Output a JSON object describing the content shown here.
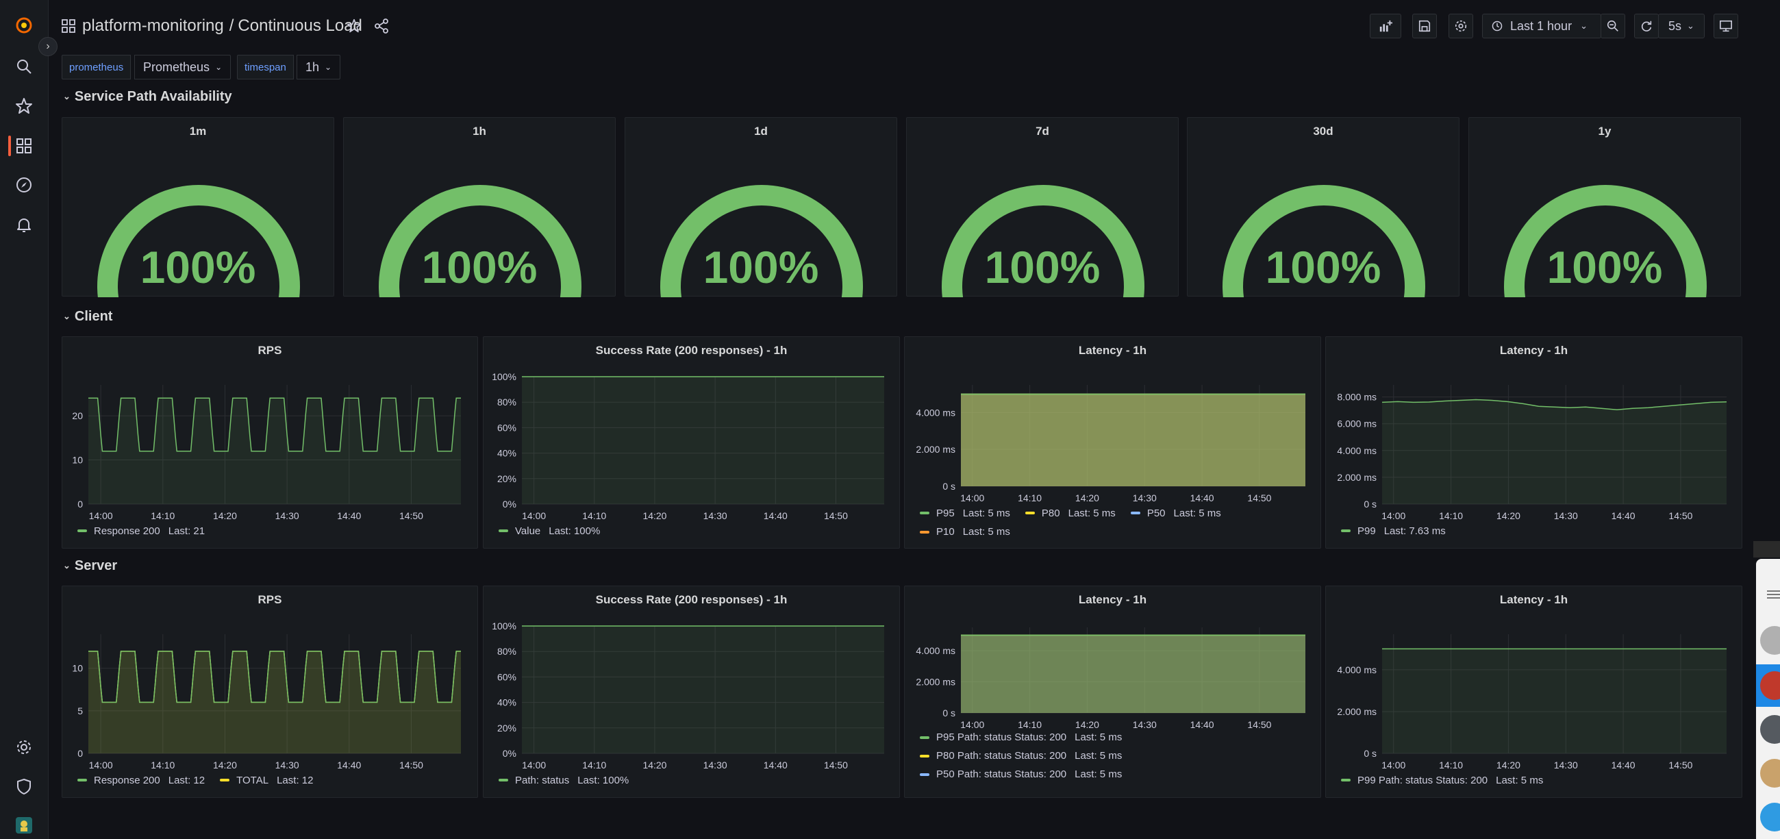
{
  "header": {
    "folder": "platform-monitoring",
    "separator": "/",
    "title": "Continuous Load",
    "time_range": "Last 1 hour",
    "refresh_interval": "5s"
  },
  "variables": [
    {
      "label": "prometheus",
      "value": "Prometheus"
    },
    {
      "label": "timespan",
      "value": "1h"
    }
  ],
  "rows": {
    "availability": "Service Path Availability",
    "client": "Client",
    "server": "Server"
  },
  "colors": {
    "green": "#73bf69",
    "yellow": "#fade2a",
    "blue": "#8ab8ff",
    "orange": "#ff9830",
    "accent": "#f55f3e"
  },
  "gauges": [
    {
      "title": "1m",
      "value": "100%"
    },
    {
      "title": "1h",
      "value": "100%"
    },
    {
      "title": "1d",
      "value": "100%"
    },
    {
      "title": "7d",
      "value": "100%"
    },
    {
      "title": "30d",
      "value": "100%"
    },
    {
      "title": "1y",
      "value": "100%"
    }
  ],
  "x_ticks_a": [
    "14:00",
    "14:10",
    "14:20",
    "14:30",
    "14:40",
    "14:50"
  ],
  "chart_data": [
    {
      "id": "client-rps",
      "type": "line",
      "title": "RPS",
      "y_ticks": [
        "0",
        "10",
        "20"
      ],
      "ylim": [
        0,
        27
      ],
      "series": [
        {
          "name": "Response 200",
          "last": "Last: 21",
          "color": "#73bf69",
          "pattern": "square-wave",
          "low": 12,
          "high": 24,
          "period_min": 6
        }
      ]
    },
    {
      "id": "client-success",
      "type": "line",
      "title": "Success Rate (200 responses) - 1h",
      "y_ticks": [
        "0%",
        "20%",
        "40%",
        "60%",
        "80%",
        "100%"
      ],
      "ylim": [
        0,
        100
      ],
      "series": [
        {
          "name": "Value",
          "last": "Last: 100%",
          "color": "#73bf69",
          "constant": 100
        }
      ]
    },
    {
      "id": "client-latency",
      "type": "area",
      "title": "Latency - 1h",
      "y_ticks": [
        "0 s",
        "2.000 ms",
        "4.000 ms"
      ],
      "ylim": [
        0,
        5500
      ],
      "series": [
        {
          "name": "P95",
          "last": "Last: 5 ms",
          "color": "#73bf69",
          "constant": 5000
        },
        {
          "name": "P80",
          "last": "Last: 5 ms",
          "color": "#fade2a",
          "constant": 5000
        },
        {
          "name": "P50",
          "last": "Last: 5 ms",
          "color": "#8ab8ff",
          "constant": 5000
        },
        {
          "name": "P10",
          "last": "Last: 5 ms",
          "color": "#ff9830",
          "constant": 5000
        }
      ]
    },
    {
      "id": "client-latency-p99",
      "type": "line",
      "title": "Latency - 1h",
      "y_ticks": [
        "0 s",
        "2.000 ms",
        "4.000 ms",
        "6.000 ms",
        "8.000 ms"
      ],
      "ylim": [
        0,
        8900
      ],
      "series": [
        {
          "name": "P99",
          "last": "Last: 7.63 ms",
          "color": "#73bf69",
          "values": [
            7600,
            7650,
            7600,
            7620,
            7700,
            7750,
            7800,
            7750,
            7650,
            7500,
            7300,
            7250,
            7200,
            7250,
            7150,
            7050,
            7150,
            7200,
            7300,
            7400,
            7500,
            7600,
            7630
          ]
        }
      ]
    },
    {
      "id": "server-rps",
      "type": "line",
      "title": "RPS",
      "y_ticks": [
        "0",
        "5",
        "10"
      ],
      "ylim": [
        0,
        14
      ],
      "series": [
        {
          "name": "Response 200",
          "last": "Last: 12",
          "color": "#73bf69",
          "pattern": "square-wave",
          "low": 6,
          "high": 12,
          "period_min": 6
        },
        {
          "name": "TOTAL",
          "last": "Last: 12",
          "color": "#fade2a",
          "pattern": "square-wave",
          "low": 6,
          "high": 12,
          "period_min": 6
        }
      ]
    },
    {
      "id": "server-success",
      "type": "line",
      "title": "Success Rate (200 responses) - 1h",
      "y_ticks": [
        "0%",
        "20%",
        "40%",
        "60%",
        "80%",
        "100%"
      ],
      "ylim": [
        0,
        100
      ],
      "series": [
        {
          "name": "Path: status",
          "last": "Last: 100%",
          "color": "#73bf69",
          "constant": 100
        }
      ]
    },
    {
      "id": "server-latency",
      "type": "area",
      "title": "Latency - 1h",
      "y_ticks": [
        "0 s",
        "2.000 ms",
        "4.000 ms"
      ],
      "ylim": [
        0,
        5500
      ],
      "series": [
        {
          "name": "P95 Path: status Status: 200",
          "last": "Last: 5 ms",
          "color": "#73bf69",
          "constant": 5000
        },
        {
          "name": "P80 Path: status Status: 200",
          "last": "Last: 5 ms",
          "color": "#fade2a",
          "constant": 5000
        },
        {
          "name": "P50 Path: status Status: 200",
          "last": "Last: 5 ms",
          "color": "#8ab8ff",
          "constant": 5000
        }
      ]
    },
    {
      "id": "server-latency-p99",
      "type": "line",
      "title": "Latency - 1h",
      "y_ticks": [
        "0 s",
        "2.000 ms",
        "4.000 ms"
      ],
      "ylim": [
        0,
        5700
      ],
      "series": [
        {
          "name": "P99 Path: status Status: 200",
          "last": "Last: 5 ms",
          "color": "#73bf69",
          "constant": 5000
        }
      ]
    }
  ]
}
